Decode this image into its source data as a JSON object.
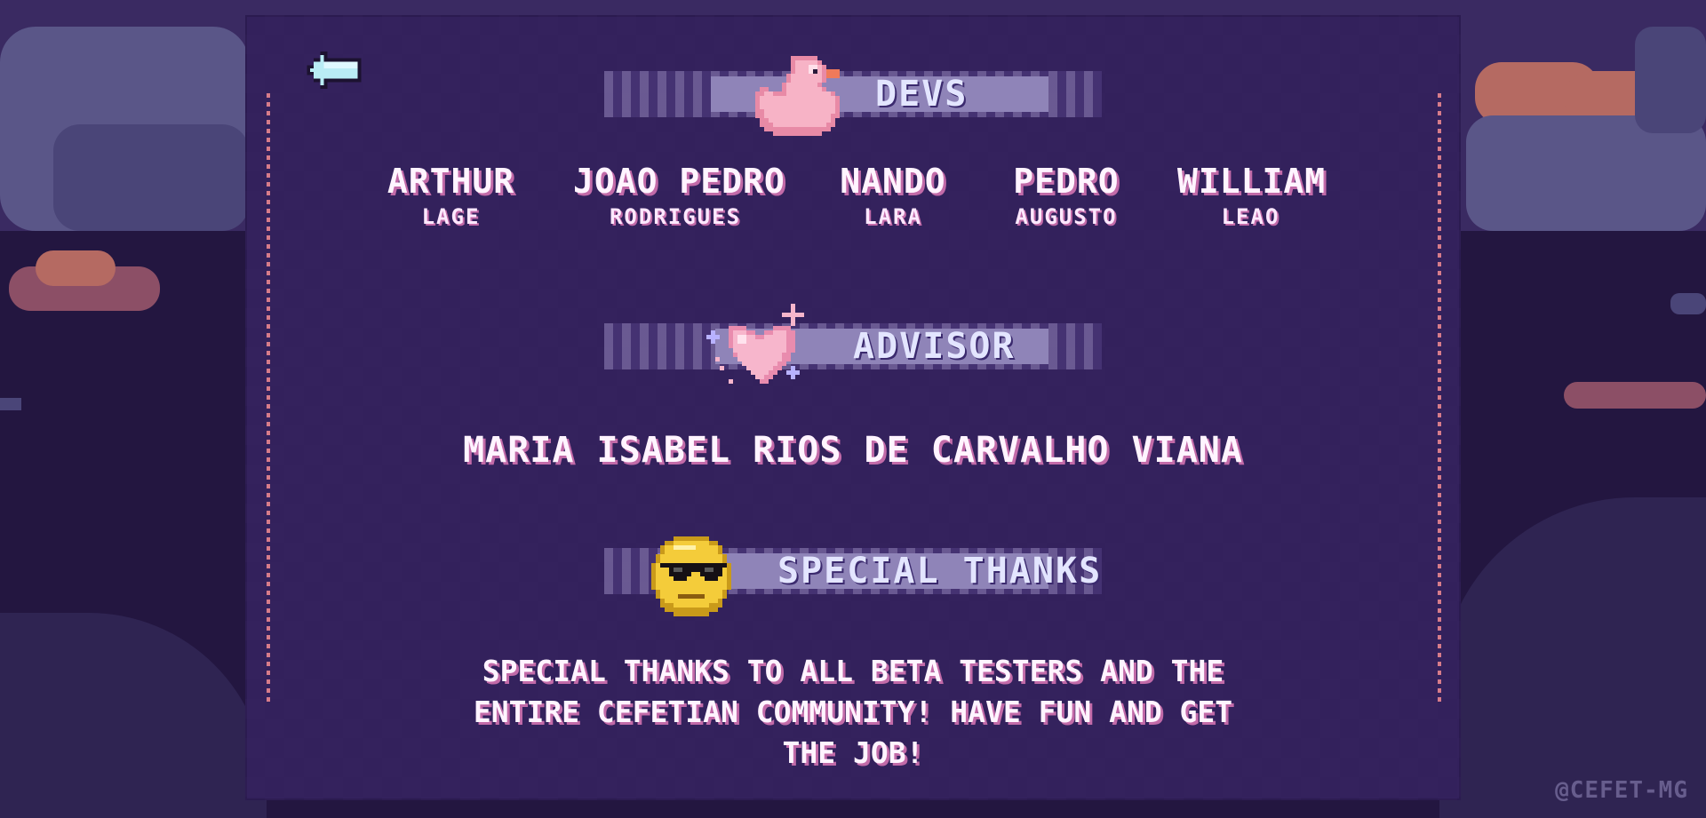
{
  "sections": {
    "devs_title": "DEVS",
    "advisor_title": "ADVISOR",
    "thanks_title": "SPECIAL THANKS"
  },
  "devs": [
    {
      "first": "ARTHUR",
      "last": "LAGE"
    },
    {
      "first": "JOAO PEDRO",
      "last": "RODRIGUES"
    },
    {
      "first": "NANDO",
      "last": "LARA"
    },
    {
      "first": "PEDRO",
      "last": "AUGUSTO"
    },
    {
      "first": "WILLIAM",
      "last": "LEAO"
    }
  ],
  "advisor_name": "MARIA ISABEL RIOS DE CARVALHO VIANA",
  "thanks_message": "SPECIAL THANKS TO ALL BETA TESTERS AND THE ENTIRE CEFETIAN COMMUNITY! HAVE FUN AND GET THE JOB!",
  "watermark": "@CEFET-MG",
  "icons": {
    "back": "back-arrow-icon",
    "devs": "rubber-duck-icon",
    "advisor": "sparkling-heart-icon",
    "thanks": "sunglasses-smiley-icon"
  },
  "colors": {
    "panel": "#33215c",
    "banner_text": "#e3e5ff",
    "name_shadow": "#c26aa8",
    "dotted_border": "#d77c8a"
  }
}
